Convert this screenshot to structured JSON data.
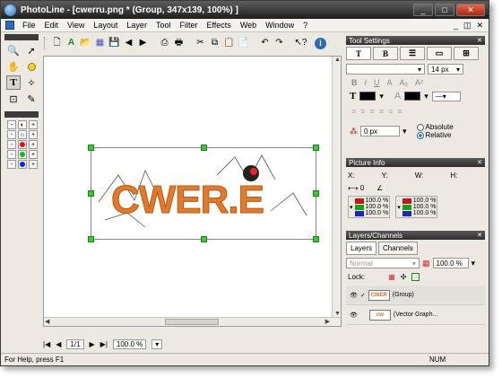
{
  "window": {
    "title": "PhotoLine - [cwerru.png * (Group, 347x139, 100%) ]",
    "controls": [
      "_",
      "□",
      "✕"
    ]
  },
  "menubar": {
    "items": [
      "File",
      "Edit",
      "View",
      "Layout",
      "Layer",
      "Tool",
      "Filter",
      "Effects",
      "Web",
      "Window",
      "?"
    ],
    "mdi_controls": [
      "_",
      "◫",
      "✕"
    ]
  },
  "toolbar": {
    "icons": [
      "new-document-icon",
      "new-text-icon",
      "open-icon",
      "browse-icon",
      "save-icon",
      "back-icon",
      "forward-icon",
      "scan-icon",
      "print-icon",
      "cut-icon",
      "copy-icon",
      "paste-icon",
      "paste-new-icon",
      "undo-icon",
      "redo-icon",
      "help-cursor-icon",
      "info-icon"
    ]
  },
  "canvas": {
    "image_text": "CWER.E",
    "image_color": "#e07a2c"
  },
  "navigation": {
    "page": "1/1",
    "zoom": "100.0 %"
  },
  "status": {
    "help_text": "For Help, press F1",
    "num": "NUM"
  },
  "tool_settings": {
    "title": "Tool Settings",
    "font_size": "14 px",
    "offset_value": "0 px",
    "absolute_label": "Absolute",
    "relative_label": "Relative"
  },
  "picture_info": {
    "title": "Picture Info",
    "x_label": "X:",
    "y_label": "Y:",
    "w_label": "W:",
    "h_label": "H:",
    "width_value": "0",
    "percent": "100.0 %"
  },
  "layers": {
    "title": "Layers/Channels",
    "tab_layers": "Layers",
    "tab_channels": "Channels",
    "mode": "Normal",
    "opacity": "100.0 %",
    "lock_label": "Lock:",
    "items": [
      {
        "name": "(Group)"
      },
      {
        "name": "(Vector Graph..."
      }
    ]
  },
  "colors": {
    "handle": "#33cc33",
    "selection_accent": "#e07a2c"
  }
}
